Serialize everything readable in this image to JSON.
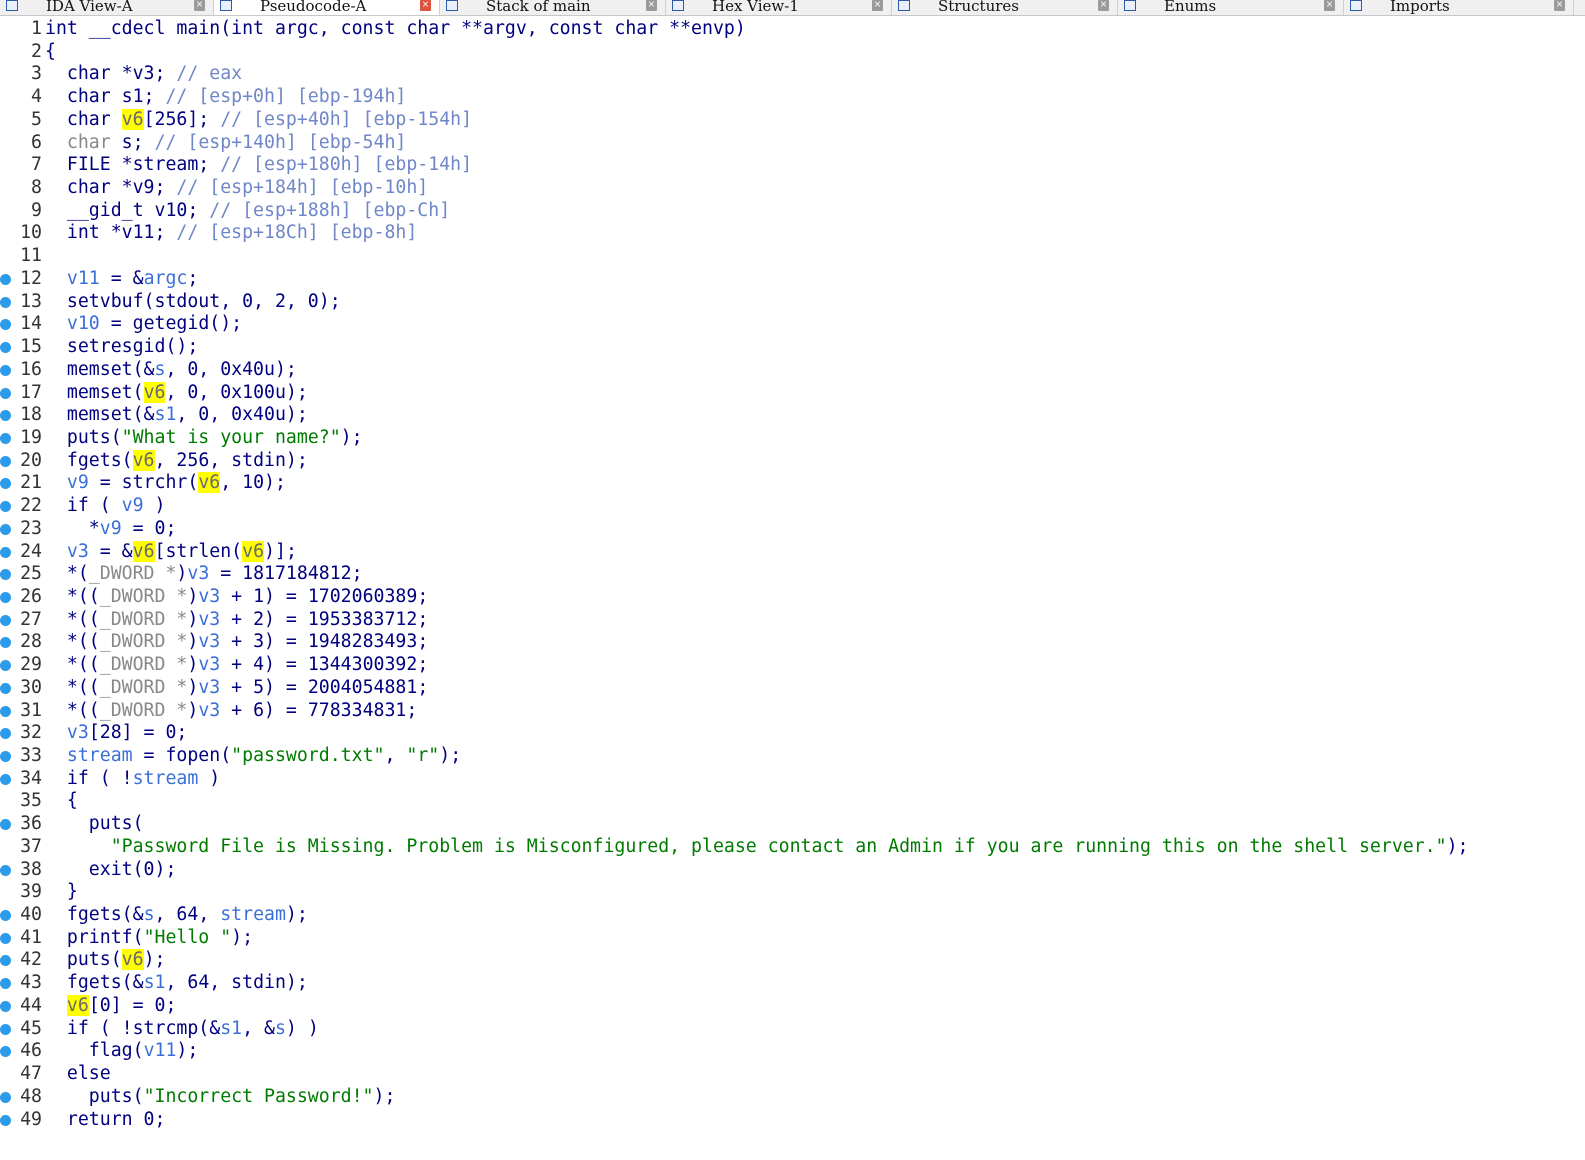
{
  "tabs": [
    {
      "label": "IDA View-A",
      "icon": "ida-view-icon",
      "active": false
    },
    {
      "label": "Pseudocode-A",
      "icon": "pseudocode-icon",
      "active": true
    },
    {
      "label": "Stack of main",
      "icon": "stack-icon",
      "active": false
    },
    {
      "label": "Hex View-1",
      "icon": "hex-view-icon",
      "active": false
    },
    {
      "label": "Structures",
      "icon": "structures-icon",
      "active": false
    },
    {
      "label": "Enums",
      "icon": "enums-icon",
      "active": false
    },
    {
      "label": "Imports",
      "icon": "imports-icon",
      "active": false
    }
  ],
  "colors": {
    "keyword": "#000080",
    "local_var": "#888888",
    "global_var": "#3b6fd8",
    "string": "#007b00",
    "comment": "#6f86c8",
    "highlight": "#ffff00",
    "breakpoint_dot": "#2b9bea"
  },
  "code_lines": [
    {
      "num": 1,
      "dot": false,
      "tokens": [
        [
          "k",
          "int __cdecl main(int argc, const char **argv, const char **envp)"
        ]
      ]
    },
    {
      "num": 2,
      "dot": false,
      "tokens": [
        [
          "k",
          "{"
        ]
      ]
    },
    {
      "num": 3,
      "dot": false,
      "tokens": [
        [
          "k",
          "  char *v3; "
        ],
        [
          "c",
          "// eax"
        ]
      ]
    },
    {
      "num": 4,
      "dot": false,
      "tokens": [
        [
          "k",
          "  char s1; "
        ],
        [
          "c",
          "// [esp+0h] [ebp-194h]"
        ]
      ]
    },
    {
      "num": 5,
      "dot": false,
      "tokens": [
        [
          "k",
          "  char "
        ],
        [
          "h",
          "v6"
        ],
        [
          "k",
          "[256]; "
        ],
        [
          "c",
          "// [esp+40h] [ebp-154h]"
        ]
      ]
    },
    {
      "num": 6,
      "dot": false,
      "tokens": [
        [
          "v",
          "  char "
        ],
        [
          "k",
          "s; "
        ],
        [
          "c",
          "// [esp+140h] [ebp-54h]"
        ]
      ]
    },
    {
      "num": 7,
      "dot": false,
      "tokens": [
        [
          "k",
          "  FILE *stream; "
        ],
        [
          "c",
          "// [esp+180h] [ebp-14h]"
        ]
      ]
    },
    {
      "num": 8,
      "dot": false,
      "tokens": [
        [
          "k",
          "  char *v9; "
        ],
        [
          "c",
          "// [esp+184h] [ebp-10h]"
        ]
      ]
    },
    {
      "num": 9,
      "dot": false,
      "tokens": [
        [
          "k",
          "  __gid_t v10; "
        ],
        [
          "c",
          "// [esp+188h] [ebp-Ch]"
        ]
      ]
    },
    {
      "num": 10,
      "dot": false,
      "tokens": [
        [
          "k",
          "  int *v11; "
        ],
        [
          "c",
          "// [esp+18Ch] [ebp-8h]"
        ]
      ]
    },
    {
      "num": 11,
      "dot": false,
      "tokens": []
    },
    {
      "num": 12,
      "dot": true,
      "tokens": [
        [
          "k",
          "  "
        ],
        [
          "vb",
          "v11"
        ],
        [
          "k",
          " = &"
        ],
        [
          "vb",
          "argc"
        ],
        [
          "k",
          ";"
        ]
      ]
    },
    {
      "num": 13,
      "dot": true,
      "tokens": [
        [
          "k",
          "  setvbuf(stdout, 0, 2, 0);"
        ]
      ]
    },
    {
      "num": 14,
      "dot": true,
      "tokens": [
        [
          "k",
          "  "
        ],
        [
          "vb",
          "v10"
        ],
        [
          "k",
          " = getegid();"
        ]
      ]
    },
    {
      "num": 15,
      "dot": true,
      "tokens": [
        [
          "k",
          "  setresgid();"
        ]
      ]
    },
    {
      "num": 16,
      "dot": true,
      "tokens": [
        [
          "k",
          "  memset(&"
        ],
        [
          "vb",
          "s"
        ],
        [
          "k",
          ", 0, 0x40u);"
        ]
      ]
    },
    {
      "num": 17,
      "dot": true,
      "tokens": [
        [
          "k",
          "  memset("
        ],
        [
          "h",
          "v6"
        ],
        [
          "k",
          ", 0, 0x100u);"
        ]
      ]
    },
    {
      "num": 18,
      "dot": true,
      "tokens": [
        [
          "k",
          "  memset(&"
        ],
        [
          "vb",
          "s1"
        ],
        [
          "k",
          ", 0, 0x40u);"
        ]
      ]
    },
    {
      "num": 19,
      "dot": true,
      "tokens": [
        [
          "k",
          "  puts("
        ],
        [
          "s",
          "\"What is your name?\""
        ],
        [
          "k",
          ");"
        ]
      ]
    },
    {
      "num": 20,
      "dot": true,
      "tokens": [
        [
          "k",
          "  fgets("
        ],
        [
          "h",
          "v6"
        ],
        [
          "k",
          ", 256, stdin);"
        ]
      ]
    },
    {
      "num": 21,
      "dot": true,
      "tokens": [
        [
          "k",
          "  "
        ],
        [
          "vb",
          "v9"
        ],
        [
          "k",
          " = strchr("
        ],
        [
          "h",
          "v6"
        ],
        [
          "k",
          ", 10);"
        ]
      ]
    },
    {
      "num": 22,
      "dot": true,
      "tokens": [
        [
          "k",
          "  if ( "
        ],
        [
          "vb",
          "v9"
        ],
        [
          "k",
          " )"
        ]
      ]
    },
    {
      "num": 23,
      "dot": true,
      "tokens": [
        [
          "k",
          "    *"
        ],
        [
          "vb",
          "v9"
        ],
        [
          "k",
          " = 0;"
        ]
      ]
    },
    {
      "num": 24,
      "dot": true,
      "tokens": [
        [
          "k",
          "  "
        ],
        [
          "vb",
          "v3"
        ],
        [
          "k",
          " = &"
        ],
        [
          "h",
          "v6"
        ],
        [
          "k",
          "[strlen("
        ],
        [
          "h",
          "v6"
        ],
        [
          "k",
          ")];"
        ]
      ]
    },
    {
      "num": 25,
      "dot": true,
      "tokens": [
        [
          "k",
          "  *("
        ],
        [
          "v",
          "_DWORD *"
        ],
        [
          "k",
          ")"
        ],
        [
          "vb",
          "v3"
        ],
        [
          "k",
          " = 1817184812;"
        ]
      ]
    },
    {
      "num": 26,
      "dot": true,
      "tokens": [
        [
          "k",
          "  *(("
        ],
        [
          "v",
          "_DWORD *"
        ],
        [
          "k",
          ")"
        ],
        [
          "vb",
          "v3"
        ],
        [
          "k",
          " + 1) = 1702060389;"
        ]
      ]
    },
    {
      "num": 27,
      "dot": true,
      "tokens": [
        [
          "k",
          "  *(("
        ],
        [
          "v",
          "_DWORD *"
        ],
        [
          "k",
          ")"
        ],
        [
          "vb",
          "v3"
        ],
        [
          "k",
          " + 2) = 1953383712;"
        ]
      ]
    },
    {
      "num": 28,
      "dot": true,
      "tokens": [
        [
          "k",
          "  *(("
        ],
        [
          "v",
          "_DWORD *"
        ],
        [
          "k",
          ")"
        ],
        [
          "vb",
          "v3"
        ],
        [
          "k",
          " + 3) = 1948283493;"
        ]
      ]
    },
    {
      "num": 29,
      "dot": true,
      "tokens": [
        [
          "k",
          "  *(("
        ],
        [
          "v",
          "_DWORD *"
        ],
        [
          "k",
          ")"
        ],
        [
          "vb",
          "v3"
        ],
        [
          "k",
          " + 4) = 1344300392;"
        ]
      ]
    },
    {
      "num": 30,
      "dot": true,
      "tokens": [
        [
          "k",
          "  *(("
        ],
        [
          "v",
          "_DWORD *"
        ],
        [
          "k",
          ")"
        ],
        [
          "vb",
          "v3"
        ],
        [
          "k",
          " + 5) = 2004054881;"
        ]
      ]
    },
    {
      "num": 31,
      "dot": true,
      "tokens": [
        [
          "k",
          "  *(("
        ],
        [
          "v",
          "_DWORD *"
        ],
        [
          "k",
          ")"
        ],
        [
          "vb",
          "v3"
        ],
        [
          "k",
          " + 6) = 778334831;"
        ]
      ]
    },
    {
      "num": 32,
      "dot": true,
      "tokens": [
        [
          "k",
          "  "
        ],
        [
          "vb",
          "v3"
        ],
        [
          "k",
          "[28] = 0;"
        ]
      ]
    },
    {
      "num": 33,
      "dot": true,
      "tokens": [
        [
          "k",
          "  "
        ],
        [
          "vb",
          "stream"
        ],
        [
          "k",
          " = fopen("
        ],
        [
          "s",
          "\"password.txt\""
        ],
        [
          "k",
          ", "
        ],
        [
          "s",
          "\"r\""
        ],
        [
          "k",
          ");"
        ]
      ]
    },
    {
      "num": 34,
      "dot": true,
      "tokens": [
        [
          "k",
          "  if ( !"
        ],
        [
          "vb",
          "stream"
        ],
        [
          "k",
          " )"
        ]
      ]
    },
    {
      "num": 35,
      "dot": false,
      "tokens": [
        [
          "k",
          "  {"
        ]
      ]
    },
    {
      "num": 36,
      "dot": true,
      "tokens": [
        [
          "k",
          "    puts("
        ]
      ]
    },
    {
      "num": 37,
      "dot": false,
      "tokens": [
        [
          "k",
          "      "
        ],
        [
          "s",
          "\"Password File is Missing. Problem is Misconfigured, please contact an Admin if you are running this on the shell server.\""
        ],
        [
          "k",
          ");"
        ]
      ]
    },
    {
      "num": 38,
      "dot": true,
      "tokens": [
        [
          "k",
          "    exit(0);"
        ]
      ]
    },
    {
      "num": 39,
      "dot": false,
      "tokens": [
        [
          "k",
          "  }"
        ]
      ]
    },
    {
      "num": 40,
      "dot": true,
      "tokens": [
        [
          "k",
          "  fgets(&"
        ],
        [
          "vb",
          "s"
        ],
        [
          "k",
          ", 64, "
        ],
        [
          "vb",
          "stream"
        ],
        [
          "k",
          ");"
        ]
      ]
    },
    {
      "num": 41,
      "dot": true,
      "tokens": [
        [
          "k",
          "  printf("
        ],
        [
          "s",
          "\"Hello \""
        ],
        [
          "k",
          ");"
        ]
      ]
    },
    {
      "num": 42,
      "dot": true,
      "tokens": [
        [
          "k",
          "  puts("
        ],
        [
          "h",
          "v6"
        ],
        [
          "k",
          ");"
        ]
      ]
    },
    {
      "num": 43,
      "dot": true,
      "tokens": [
        [
          "k",
          "  fgets(&"
        ],
        [
          "vb",
          "s1"
        ],
        [
          "k",
          ", 64, stdin);"
        ]
      ]
    },
    {
      "num": 44,
      "dot": true,
      "tokens": [
        [
          "k",
          "  "
        ],
        [
          "h",
          "v6"
        ],
        [
          "k",
          "[0] = 0;"
        ]
      ]
    },
    {
      "num": 45,
      "dot": true,
      "tokens": [
        [
          "k",
          "  if ( !strcmp(&"
        ],
        [
          "vb",
          "s1"
        ],
        [
          "k",
          ", &"
        ],
        [
          "vb",
          "s"
        ],
        [
          "k",
          ") )"
        ]
      ]
    },
    {
      "num": 46,
      "dot": true,
      "tokens": [
        [
          "k",
          "    flag("
        ],
        [
          "vb",
          "v11"
        ],
        [
          "k",
          ");"
        ]
      ]
    },
    {
      "num": 47,
      "dot": false,
      "tokens": [
        [
          "k",
          "  else"
        ]
      ]
    },
    {
      "num": 48,
      "dot": true,
      "tokens": [
        [
          "k",
          "    puts("
        ],
        [
          "s",
          "\"Incorrect Password!\""
        ],
        [
          "k",
          ");"
        ]
      ]
    },
    {
      "num": 49,
      "dot": true,
      "tokens": [
        [
          "k",
          "  return 0;"
        ]
      ]
    }
  ]
}
